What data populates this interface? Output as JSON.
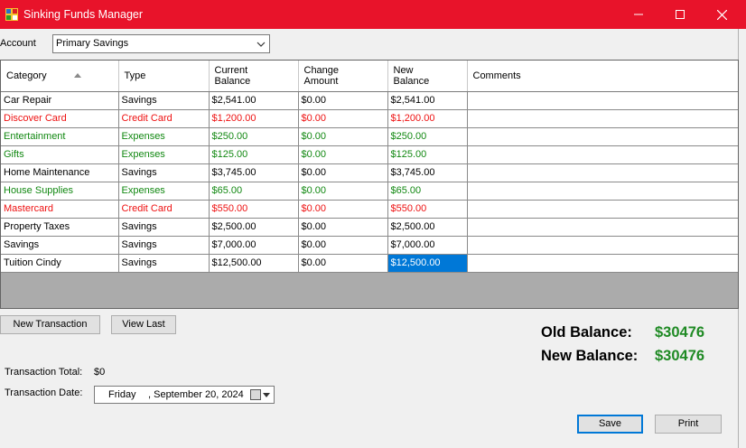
{
  "window": {
    "title": "Sinking Funds Manager",
    "accent_color": "#e8132a"
  },
  "account": {
    "label": "Account",
    "selected": "Primary Savings"
  },
  "grid": {
    "headers": {
      "category": "Category",
      "type": "Type",
      "current_balance_1": "Current",
      "current_balance_2": "Balance",
      "change_amount_1": "Change",
      "change_amount_2": "Amount",
      "new_balance_1": "New",
      "new_balance_2": "Balance",
      "comments": "Comments"
    },
    "rows": [
      {
        "category": "Car Repair",
        "type": "Savings",
        "current": "$2,541.00",
        "change": "$0.00",
        "new": "$2,541.00",
        "comments": "",
        "color": "black"
      },
      {
        "category": "Discover Card",
        "type": "Credit Card",
        "current": "$1,200.00",
        "change": "$0.00",
        "new": "$1,200.00",
        "comments": "",
        "color": "red"
      },
      {
        "category": "Entertainment",
        "type": "Expenses",
        "current": "$250.00",
        "change": "$0.00",
        "new": "$250.00",
        "comments": "",
        "color": "green"
      },
      {
        "category": "Gifts",
        "type": "Expenses",
        "current": "$125.00",
        "change": "$0.00",
        "new": "$125.00",
        "comments": "",
        "color": "green"
      },
      {
        "category": "Home Maintenance",
        "type": "Savings",
        "current": "$3,745.00",
        "change": "$0.00",
        "new": "$3,745.00",
        "comments": "",
        "color": "black"
      },
      {
        "category": "House Supplies",
        "type": "Expenses",
        "current": "$65.00",
        "change": "$0.00",
        "new": "$65.00",
        "comments": "",
        "color": "green"
      },
      {
        "category": "Mastercard",
        "type": "Credit Card",
        "current": "$550.00",
        "change": "$0.00",
        "new": "$550.00",
        "comments": "",
        "color": "red"
      },
      {
        "category": "Property Taxes",
        "type": "Savings",
        "current": "$2,500.00",
        "change": "$0.00",
        "new": "$2,500.00",
        "comments": "",
        "color": "black"
      },
      {
        "category": "Savings",
        "type": "Savings",
        "current": "$7,000.00",
        "change": "$0.00",
        "new": "$7,000.00",
        "comments": "",
        "color": "black"
      },
      {
        "category": "Tuition Cindy",
        "type": "Savings",
        "current": "$12,500.00",
        "change": "$0.00",
        "new": "$12,500.00",
        "comments": "",
        "color": "black",
        "selected_col": "new"
      }
    ]
  },
  "buttons": {
    "new_transaction": "New Transaction",
    "view_last": "View Last",
    "save": "Save",
    "print": "Print"
  },
  "balances": {
    "old_label": "Old Balance:",
    "old_value": "$30476",
    "new_label": "New Balance:",
    "new_value": "$30476",
    "value_color": "#1f8a24"
  },
  "transaction": {
    "total_label": "Transaction Total:",
    "total_value": "$0",
    "date_label": "Transaction Date:",
    "date_day": "Friday",
    "date_rest": ", September 20, 2024"
  }
}
